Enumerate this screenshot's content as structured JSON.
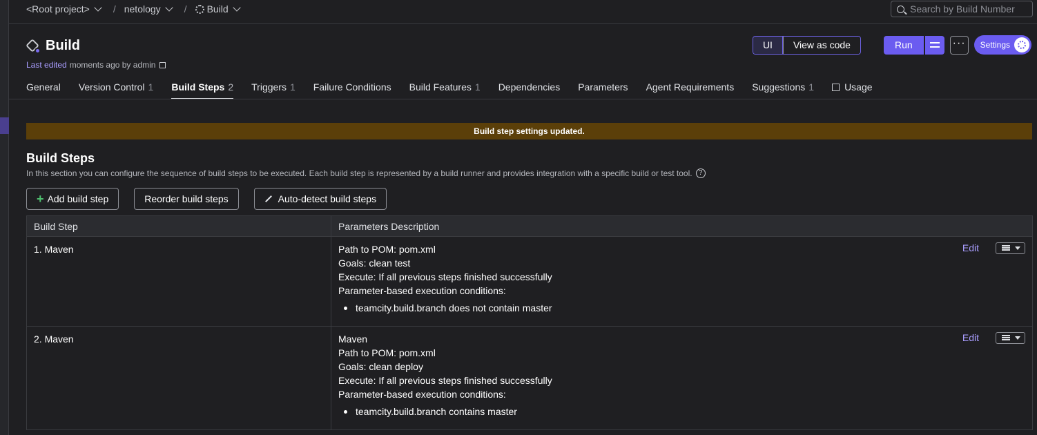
{
  "breadcrumbs": [
    "<Root project>",
    "netology",
    "Build"
  ],
  "search": {
    "placeholder": "Search by Build Number"
  },
  "header": {
    "title": "Build",
    "last_edited_link": "Last edited",
    "last_edited_text": "moments ago by admin"
  },
  "actions": {
    "ui": "UI",
    "view_as_code": "View as code",
    "run": "Run",
    "more": "···",
    "settings": "Settings"
  },
  "tabs": [
    {
      "label": "General",
      "count": ""
    },
    {
      "label": "Version Control",
      "count": "1"
    },
    {
      "label": "Build Steps",
      "count": "2"
    },
    {
      "label": "Triggers",
      "count": "1"
    },
    {
      "label": "Failure Conditions",
      "count": ""
    },
    {
      "label": "Build Features",
      "count": "1"
    },
    {
      "label": "Dependencies",
      "count": ""
    },
    {
      "label": "Parameters",
      "count": ""
    },
    {
      "label": "Agent Requirements",
      "count": ""
    },
    {
      "label": "Suggestions",
      "count": "1"
    },
    {
      "label": "Usage",
      "count": ""
    }
  ],
  "banner": "Build step settings updated.",
  "section": {
    "title": "Build Steps",
    "description": "In this section you can configure the sequence of build steps to be executed. Each build step is represented by a build runner and provides integration with a specific build or test tool.",
    "help": "?"
  },
  "buttons": {
    "add": "Add build step",
    "reorder": "Reorder build steps",
    "autodetect": "Auto-detect build steps"
  },
  "table": {
    "headers": [
      "Build Step",
      "Parameters Description"
    ],
    "edit_label": "Edit",
    "rows": [
      {
        "step": "1. Maven",
        "lines": [
          "Path to POM: pom.xml",
          "Goals: clean test",
          "Execute: If all previous steps finished successfully",
          "Parameter-based execution conditions:"
        ],
        "bullet": "teamcity.build.branch does not contain master"
      },
      {
        "step": "2. Maven",
        "lines": [
          "Maven",
          "Path to POM: pom.xml",
          "Goals: clean deploy",
          "Execute: If all previous steps finished successfully",
          "Parameter-based execution conditions:"
        ],
        "bullet": "teamcity.build.branch contains master"
      }
    ]
  },
  "colors": {
    "accent": "#6b5cf0",
    "banner_bg": "#5b3f09",
    "link": "#a99dff",
    "background": "#1f1f22"
  }
}
